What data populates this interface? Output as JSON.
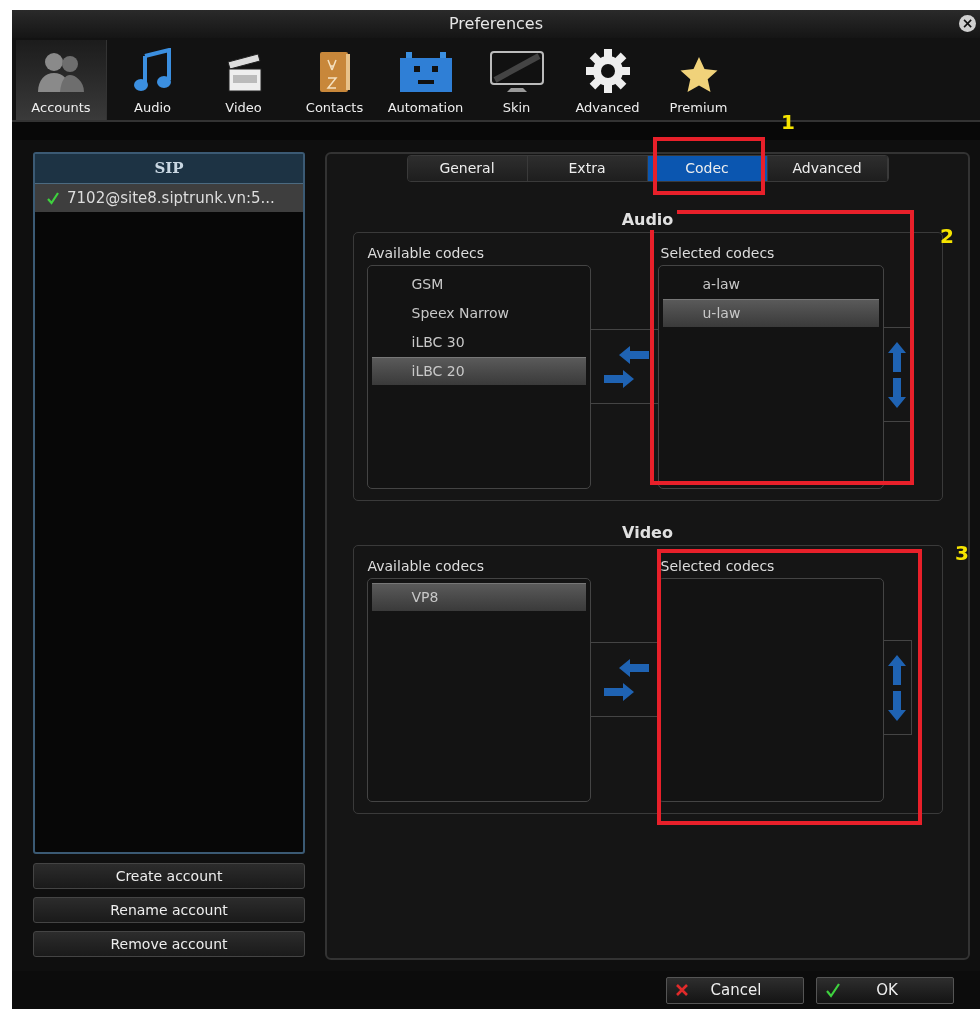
{
  "window": {
    "title": "Preferences",
    "close": "×"
  },
  "toolbar": [
    {
      "label": "Accounts",
      "selected": true
    },
    {
      "label": "Audio",
      "selected": false
    },
    {
      "label": "Video",
      "selected": false
    },
    {
      "label": "Contacts",
      "selected": false
    },
    {
      "label": "Automation",
      "selected": false
    },
    {
      "label": "Skin",
      "selected": false
    },
    {
      "label": "Advanced",
      "selected": false
    },
    {
      "label": "Premium",
      "selected": false
    }
  ],
  "accounts": {
    "header": "SIP",
    "items": [
      {
        "label": "7102@site8.siptrunk.vn:5...",
        "selected": true
      }
    ]
  },
  "account_buttons": [
    "Create account",
    "Rename account",
    "Remove account"
  ],
  "tabs": [
    {
      "label": "General",
      "selected": false
    },
    {
      "label": "Extra",
      "selected": false
    },
    {
      "label": "Codec",
      "selected": true
    },
    {
      "label": "Advanced",
      "selected": false
    }
  ],
  "sections": [
    {
      "title": "Audio",
      "available": {
        "label": "Available codecs",
        "items": [
          {
            "label": "GSM",
            "selected": false
          },
          {
            "label": "Speex Narrow",
            "selected": false
          },
          {
            "label": "iLBC 30",
            "selected": false
          },
          {
            "label": "iLBC 20",
            "selected": true
          }
        ]
      },
      "chosen": {
        "label": "Selected codecs",
        "items": [
          {
            "label": "a-law",
            "selected": false
          },
          {
            "label": "u-law",
            "selected": true
          }
        ]
      }
    },
    {
      "title": "Video",
      "available": {
        "label": "Available codecs",
        "items": [
          {
            "label": "VP8",
            "selected": true
          }
        ]
      },
      "chosen": {
        "label": "Selected codecs"
      }
    }
  ],
  "buttons": [
    {
      "label": "Cancel",
      "kind": "cancel"
    },
    {
      "label": "OK",
      "kind": "ok"
    }
  ],
  "annotations": [
    {
      "label": "1"
    },
    {
      "label": "2"
    },
    {
      "label": "3"
    }
  ]
}
